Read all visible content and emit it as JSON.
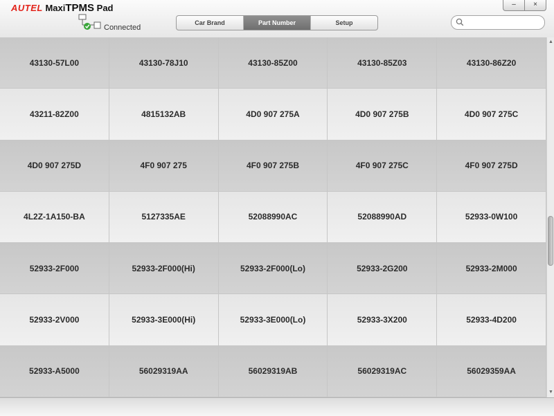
{
  "app": {
    "brand": "AUTEL",
    "product_pre": "Maxi",
    "product_bold": "TPMS",
    "product_post": " Pad"
  },
  "connection": {
    "status": "Connected",
    "icon": "network-connected-icon"
  },
  "tabs": [
    {
      "label": "Car Brand",
      "active": false
    },
    {
      "label": "Part Number",
      "active": true
    },
    {
      "label": "Setup",
      "active": false
    }
  ],
  "search": {
    "placeholder": "",
    "value": ""
  },
  "window": {
    "minimize_label": "–",
    "close_label": "×"
  },
  "colors": {
    "brand_red": "#e2231a",
    "active_tab": "#7d7d7d"
  },
  "parts": [
    [
      "43130-57L00",
      "43130-78J10",
      "43130-85Z00",
      "43130-85Z03",
      "43130-86Z20"
    ],
    [
      "43211-82Z00",
      "4815132AB",
      "4D0 907 275A",
      "4D0 907 275B",
      "4D0 907 275C"
    ],
    [
      "4D0 907 275D",
      "4F0 907 275",
      "4F0 907 275B",
      "4F0 907 275C",
      "4F0 907 275D"
    ],
    [
      "4L2Z-1A150-BA",
      "5127335AE",
      "52088990AC",
      "52088990AD",
      "52933-0W100"
    ],
    [
      "52933-2F000",
      "52933-2F000(Hi)",
      "52933-2F000(Lo)",
      "52933-2G200",
      "52933-2M000"
    ],
    [
      "52933-2V000",
      "52933-3E000(Hi)",
      "52933-3E000(Lo)",
      "52933-3X200",
      "52933-4D200"
    ],
    [
      "52933-A5000",
      "56029319AA",
      "56029319AB",
      "56029319AC",
      "56029359AA"
    ]
  ]
}
